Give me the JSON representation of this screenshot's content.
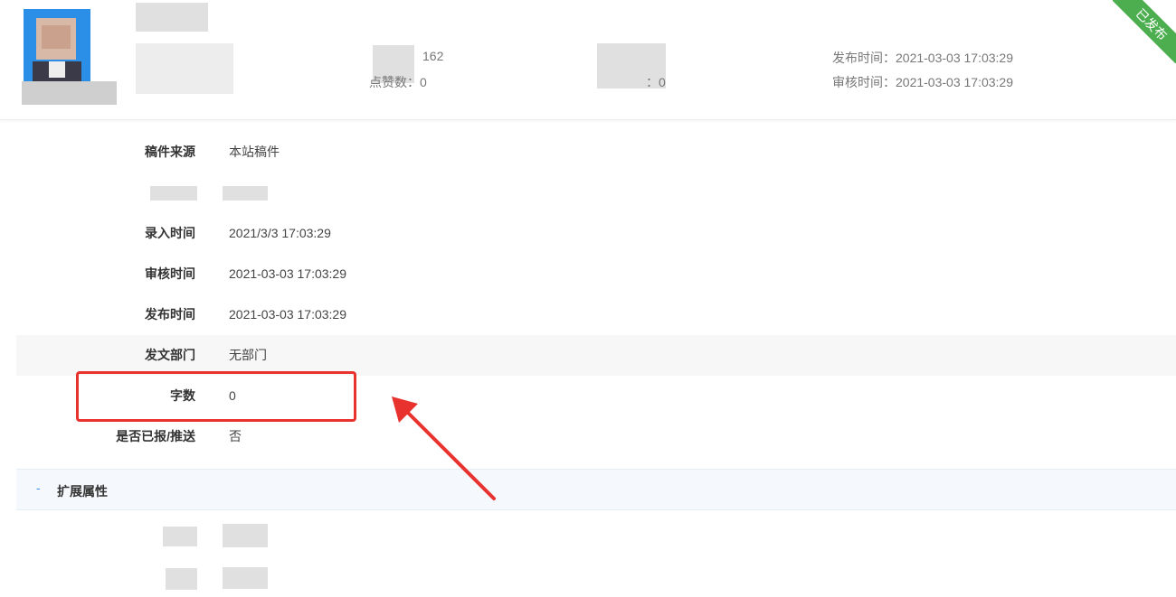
{
  "header": {
    "stats": {
      "views_value": "162",
      "likes_label": "点赞数",
      "likes_value": "0",
      "other_count_value": "0",
      "publish_time": "发布时间：2021-03-03 17:03:29",
      "review_time": "审核时间：2021-03-03 17:03:29"
    },
    "status_badge": "已发布"
  },
  "fields": [
    {
      "label": "稿件来源",
      "value": "本站稿件"
    },
    {
      "label": "录入时间",
      "value": "2021/3/3 17:03:29"
    },
    {
      "label": "审核时间",
      "value": "2021-03-03 17:03:29"
    },
    {
      "label": "发布时间",
      "value": "2021-03-03 17:03:29"
    },
    {
      "label": "发文部门",
      "value": "无部门"
    },
    {
      "label": "字数",
      "value": "0"
    },
    {
      "label": "是否已报/推送",
      "value": "否"
    }
  ],
  "extended_section": {
    "toggle_symbol": "-",
    "title": "扩展属性"
  },
  "colors": {
    "badge": "#4cae4f",
    "highlight": "#e8322e",
    "accent": "#3a8ee6"
  }
}
